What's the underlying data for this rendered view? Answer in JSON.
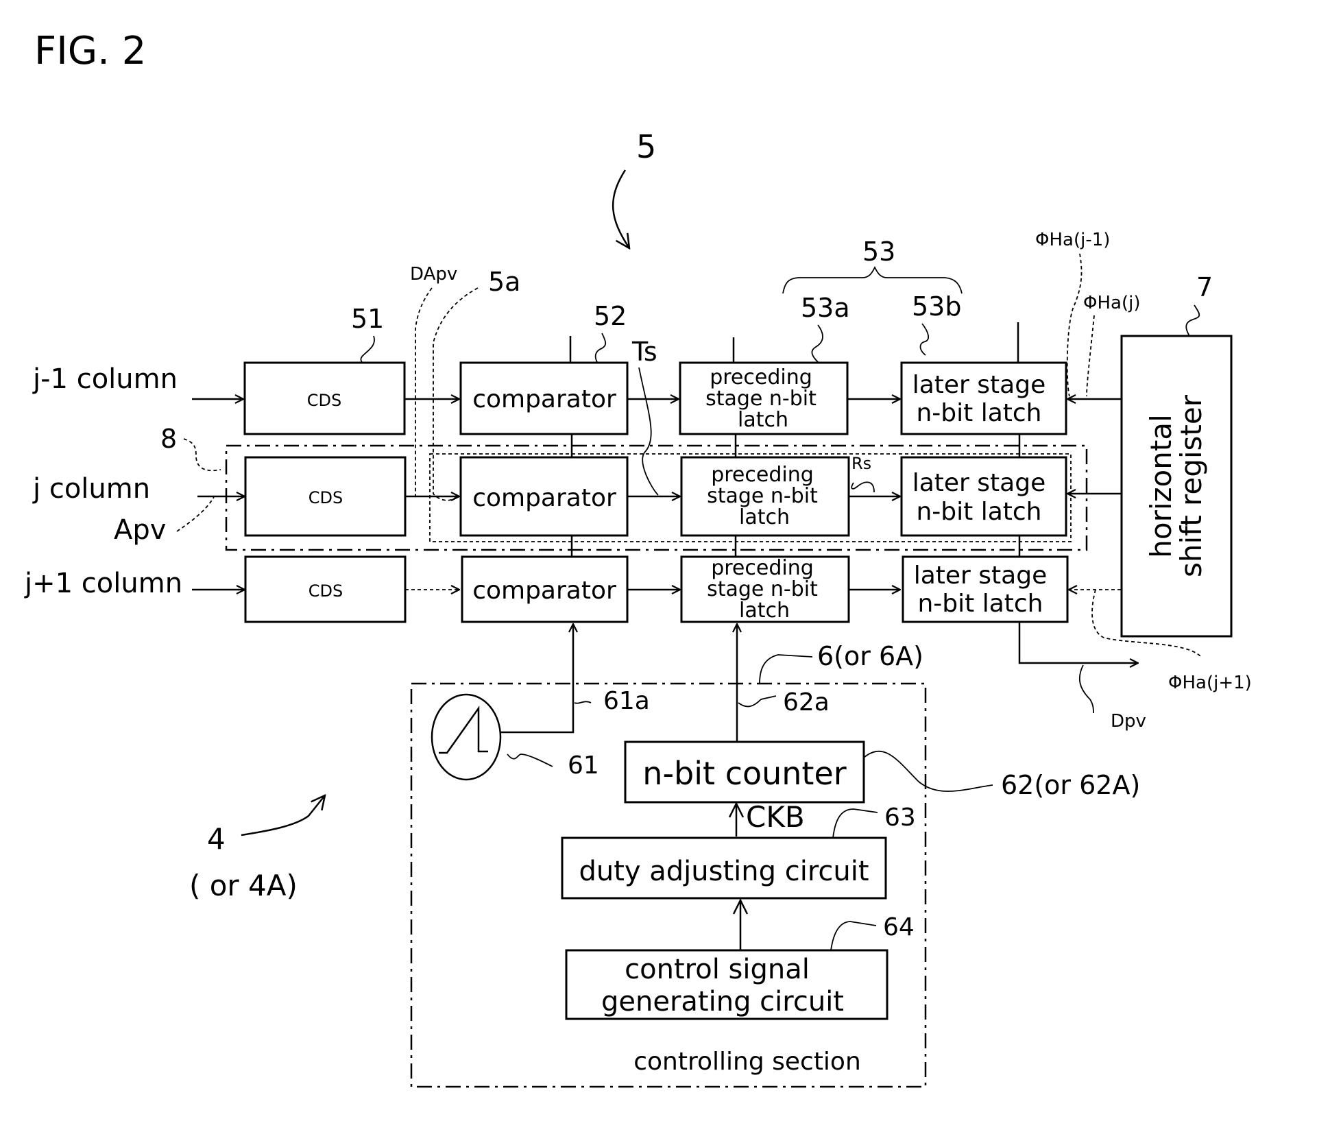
{
  "figure": {
    "title": "FIG. 2"
  },
  "refs": {
    "r5": "5",
    "r5a": "5a",
    "r51": "51",
    "r52": "52",
    "r53": "53",
    "r53a": "53a",
    "r53b": "53b",
    "r7": "7",
    "r8": "8",
    "r61": "61",
    "r61a": "61a",
    "r62": "62(or 62A)",
    "r62a": "62a",
    "r63": "63",
    "r64": "64",
    "r6": "6(or 6A)",
    "r4": "4",
    "r4a": "( or 4A)"
  },
  "signals": {
    "dapv": "DApv",
    "apv": "Apv",
    "ts": "Ts",
    "rs": "Rs",
    "ha_jm1": "ΦHa(j-1)",
    "ha_j": "ΦHa(j)",
    "ha_jp1": "ΦHa(j+1)",
    "dpv": "Dpv",
    "ckb": "CKB"
  },
  "columns": [
    {
      "label": "j-1 column",
      "cds": "CDS",
      "comparator": "comparator",
      "pre_latch": [
        "preceding",
        "stage n-bit",
        "latch"
      ],
      "post_latch": [
        "later stage",
        "n-bit latch"
      ]
    },
    {
      "label": "j column",
      "cds": "CDS",
      "comparator": "comparator",
      "pre_latch": [
        "preceding",
        "stage n-bit",
        "latch"
      ],
      "post_latch": [
        "later stage",
        "n-bit latch"
      ]
    },
    {
      "label": "j+1 column",
      "cds": "CDS",
      "comparator": "comparator",
      "pre_latch": [
        "preceding",
        "stage n-bit",
        "latch"
      ],
      "post_latch": [
        "later stage",
        "n-bit latch"
      ]
    }
  ],
  "shift_register": [
    "horizontal",
    "shift register"
  ],
  "control": {
    "counter": "n-bit counter",
    "duty": "duty adjusting circuit",
    "ctrl_gen": [
      "control signal",
      "generating circuit"
    ],
    "section_label": "controlling section"
  }
}
